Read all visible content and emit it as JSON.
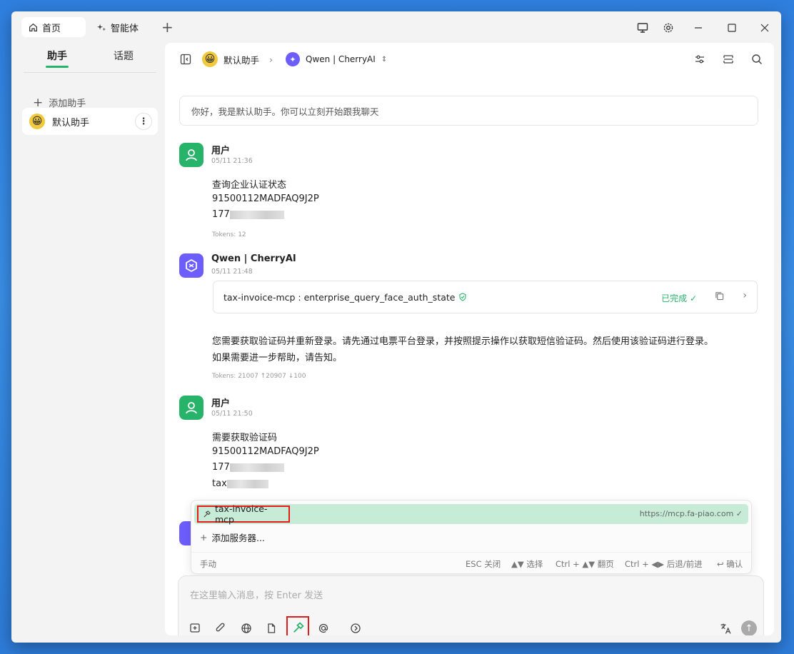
{
  "tabs": {
    "home": "首页",
    "agents": "智能体",
    "add": "+"
  },
  "sidebar": {
    "tab_assistant": "助手",
    "tab_topics": "话题",
    "add_assistant": "添加助手",
    "assistant_name": "默认助手",
    "assistant_emoji": "😀"
  },
  "topbar": {
    "assistant": "默认助手",
    "model": "Qwen | CherryAI"
  },
  "intro": "你好，我是默认助手。你可以立刻开始跟我聊天",
  "messages": [
    {
      "name": "用户",
      "time": "05/11 21:36",
      "lines": [
        "查询企业认证状态",
        "91500112MADFAQ9J2P",
        "177"
      ],
      "tokens": "Tokens: 12"
    },
    {
      "name": "Qwen | CherryAI",
      "time": "05/11 21:48",
      "tool": "tax-invoice-mcp : enterprise_query_face_auth_state",
      "tool_status": "已完成",
      "lines": [
        "您需要获取验证码并重新登录。请先通过电票平台登录，并按照提示操作以获取短信验证码。然后使用该验证码进行登录。",
        "如果需要进一步帮助，请告知。"
      ],
      "tokens": "Tokens: 21007 ↑20907 ↓100"
    },
    {
      "name": "用户",
      "time": "05/11 21:50",
      "lines": [
        "需要获取验证码",
        "91500112MADFAQ9J2P",
        "177",
        "tax"
      ]
    }
  ],
  "popup": {
    "server_name": "tax-invoice-mcp",
    "server_url": "https://mcp.fa-piao.com",
    "add_server": "添加服务器...",
    "mode": "手动",
    "hints": [
      "ESC 关闭",
      "▲▼ 选择",
      "Ctrl + ▲▼ 翻页",
      "Ctrl + ◀▶ 后退/前进",
      "↩ 确认"
    ]
  },
  "input": {
    "placeholder": "在这里输入消息，按 Enter 发送"
  },
  "colors": {
    "accent": "#27b36a",
    "model": "#6d5dfc",
    "highlight": "#e21b1b"
  }
}
